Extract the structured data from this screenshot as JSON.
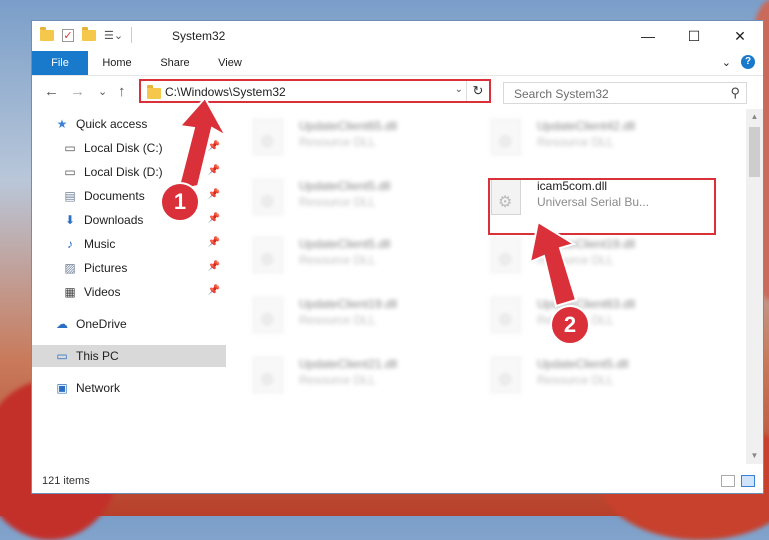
{
  "window": {
    "title": "System32",
    "controls": {
      "minimize": "—",
      "maximize": "☐",
      "close": "✕"
    }
  },
  "ribbon": {
    "tabs": [
      "File",
      "Home",
      "Share",
      "View"
    ],
    "expand": "⌄",
    "help": "?"
  },
  "address": {
    "path": "C:\\Windows\\System32",
    "dropdown": "⌄",
    "refresh": "↻"
  },
  "nav": {
    "back": "←",
    "forward": "→",
    "recent": "⌄",
    "up": "↑"
  },
  "search": {
    "placeholder": "Search System32",
    "icon": "⚲"
  },
  "sidebar": {
    "items": [
      {
        "label": "Quick access",
        "icon": "star-icon",
        "glyph": "★",
        "color": "#3a80d6",
        "pinned": false
      },
      {
        "label": "Local Disk (C:)",
        "icon": "drive-icon",
        "glyph": "▭",
        "color": "#555555",
        "pinned": true
      },
      {
        "label": "Local Disk (D:)",
        "icon": "drive-icon",
        "glyph": "▭",
        "color": "#555555",
        "pinned": true
      },
      {
        "label": "Documents",
        "icon": "documents-icon",
        "glyph": "▤",
        "color": "#6b7d95",
        "pinned": true
      },
      {
        "label": "Downloads",
        "icon": "download-icon",
        "glyph": "⬇",
        "color": "#2a6fc4",
        "pinned": true
      },
      {
        "label": "Music",
        "icon": "music-icon",
        "glyph": "♪",
        "color": "#2a6fc4",
        "pinned": true
      },
      {
        "label": "Pictures",
        "icon": "pictures-icon",
        "glyph": "▨",
        "color": "#6b7d95",
        "pinned": true
      },
      {
        "label": "Videos",
        "icon": "videos-icon",
        "glyph": "▦",
        "color": "#444444",
        "pinned": true
      },
      {
        "label": "OneDrive",
        "icon": "cloud-icon",
        "glyph": "☁",
        "color": "#2a6fc4",
        "pinned": false
      },
      {
        "label": "This PC",
        "icon": "computer-icon",
        "glyph": "▭",
        "color": "#2a6fc4",
        "pinned": false
      },
      {
        "label": "Network",
        "icon": "network-icon",
        "glyph": "▣",
        "color": "#2a6fc4",
        "pinned": false
      }
    ],
    "selected": "This PC",
    "pin_glyph": "📌"
  },
  "files": {
    "left_column": [
      {
        "name": "UpdateClient65.dll",
        "type": "Resource DLL"
      },
      {
        "name": "UpdateClient5.dll",
        "type": "Resource DLL"
      },
      {
        "name": "UpdateClient5.dll",
        "type": "Resource DLL"
      },
      {
        "name": "UpdateClient19.dll",
        "type": "Resource DLL"
      },
      {
        "name": "UpdateClient21.dll",
        "type": "Resource DLL"
      }
    ],
    "right_column": [
      {
        "name": "UpdateClient42.dll",
        "type": "Resource DLL"
      },
      {
        "name": "icam5com.dll",
        "type": "Universal Serial Bu...",
        "highlighted": true
      },
      {
        "name": "UpdateClient19.dll",
        "type": "Resource DLL"
      },
      {
        "name": "UpdateClient63.dll",
        "type": "Resource DLL"
      },
      {
        "name": "UpdateClient5.dll",
        "type": "Resource DLL"
      }
    ]
  },
  "status": {
    "item_count": "121 items"
  },
  "callouts": [
    "1",
    "2"
  ],
  "colors": {
    "accent": "#1979ca",
    "callout": "#d9303a"
  }
}
